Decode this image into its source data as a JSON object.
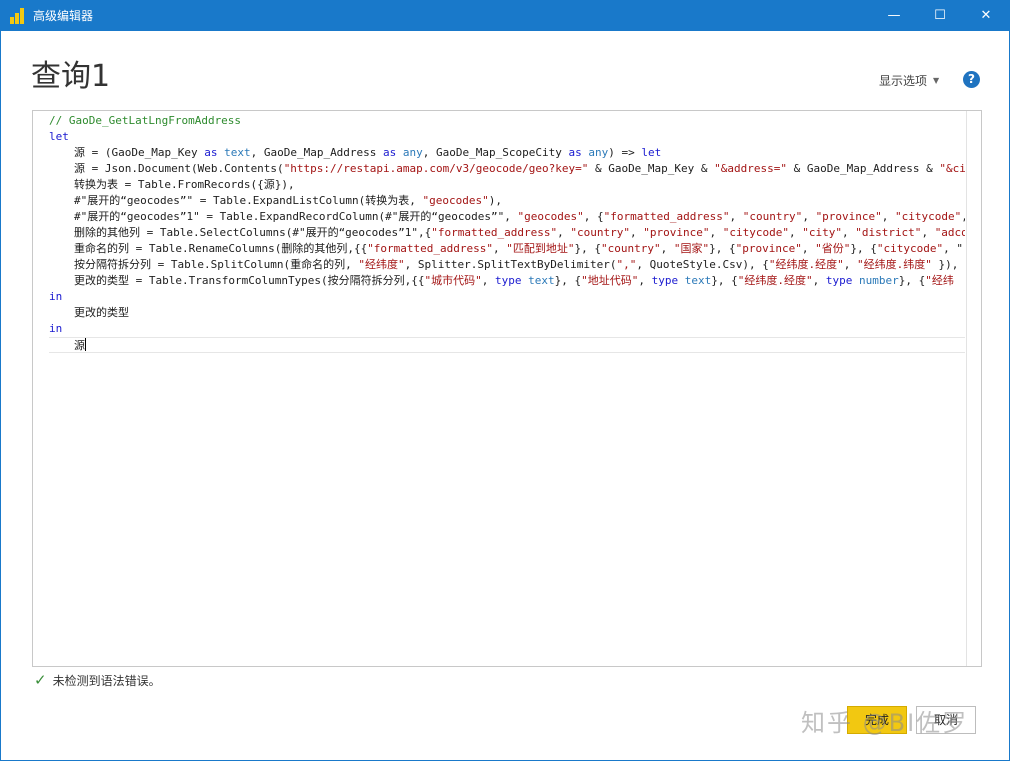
{
  "window": {
    "title": "高级编辑器",
    "minimize_glyph": "—",
    "maximize_glyph": "☐",
    "close_glyph": "✕",
    "icon": "power-bi-icon",
    "accent_color": "#1979ca"
  },
  "header": {
    "query_title": "查询1",
    "display_options_label": "显示选项",
    "help_glyph": "?"
  },
  "editor": {
    "comment": "// GaoDe_GetLatLngFromAddress",
    "kw_let": "let",
    "line1": {
      "a": "源 = (GaoDe_Map_Key ",
      "as1": "as",
      "t1": "text",
      "b": ", GaoDe_Map_Address ",
      "as2": "as",
      "t2": "any",
      "c": ", GaoDe_Map_ScopeCity ",
      "as3": "as",
      "t3": "any",
      "d": ") => ",
      "let": "let"
    },
    "line2": {
      "a": "源 = Json.Document(Web.Contents(",
      "s1": "\"https://restapi.amap.com/v3/geocode/geo?key=\"",
      "b": " & GaoDe_Map_Key & ",
      "s2": "\"&address=\"",
      "c": " & GaoDe_Map_Address & ",
      "s3": "\"&city=\""
    },
    "line3": "转换为表 = Table.FromRecords({源}),",
    "line4": {
      "a": "#\"展开的“geocodes”\" = Table.ExpandListColumn(转换为表, ",
      "s1": "\"geocodes\"",
      "b": "),"
    },
    "line5": {
      "a": "#\"展开的“geocodes”1\" = Table.ExpandRecordColumn(#\"展开的“geocodes”\", ",
      "s1": "\"geocodes\"",
      "b": ", {",
      "s2": "\"formatted_address\"",
      "c": ", ",
      "s3": "\"country\"",
      "d": ", ",
      "s4": "\"province\"",
      "e": ", ",
      "s5": "\"citycode\"",
      "f": ", \""
    },
    "line6": {
      "a": "删除的其他列 = Table.SelectColumns(#\"展开的“geocodes”1\",{",
      "s1": "\"formatted_address\"",
      "b": ", ",
      "s2": "\"country\"",
      "c": ", ",
      "s3": "\"province\"",
      "d": ", ",
      "s4": "\"citycode\"",
      "e": ", ",
      "s5": "\"city\"",
      "f": ", ",
      "s6": "\"district\"",
      "g": ", ",
      "s7": "\"adcode\""
    },
    "line7": {
      "a": "重命名的列 = Table.RenameColumns(删除的其他列,{{",
      "s1": "\"formatted_address\"",
      "b": ", ",
      "s2": "\"匹配到地址\"",
      "c": "}, {",
      "s3": "\"country\"",
      "d": ", ",
      "s4": "\"国家\"",
      "e": "}, {",
      "s5": "\"province\"",
      "f": ", ",
      "s6": "\"省份\"",
      "g": "}, {",
      "s7": "\"citycode\"",
      "h": ", \""
    },
    "line8": {
      "a": "按分隔符拆分列 = Table.SplitColumn(重命名的列, ",
      "s1": "\"经纬度\"",
      "b": ", Splitter.SplitTextByDelimiter(",
      "s2": "\",\"",
      "c": ", QuoteStyle.Csv), {",
      "s3": "\"经纬度.经度\"",
      "d": ", ",
      "s4": "\"经纬度.纬度\"",
      "e": " }),"
    },
    "line9": {
      "a": "更改的类型 = Table.TransformColumnTypes(按分隔符拆分列,{{",
      "s1": "\"城市代码\"",
      "b": ", ",
      "t1": "type",
      "c": " ",
      "t1b": "text",
      "d": "}, {",
      "s2": "\"地址代码\"",
      "e": ", ",
      "t2": "type",
      "f": " ",
      "t2b": "text",
      "g": "}, {",
      "s3": "\"经纬度.经度\"",
      "h": ", ",
      "t3": "type",
      "i": " ",
      "t3b": "number",
      "j": "}, {",
      "s4": "\"经纬"
    },
    "kw_in1": "in",
    "line10": "更改的类型",
    "kw_in2": "in",
    "line11": "源"
  },
  "status": {
    "message": "未检测到语法错误。",
    "icon": "check-icon"
  },
  "footer": {
    "done_label": "完成",
    "cancel_label": "取消",
    "watermark": "知乎 @BI佐罗"
  }
}
